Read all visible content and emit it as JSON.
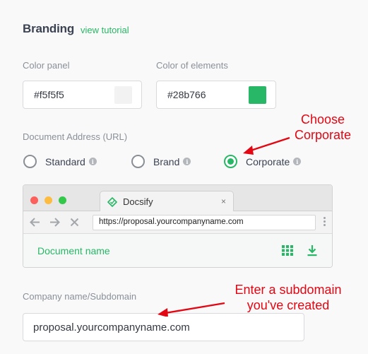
{
  "branding": {
    "title": "Branding",
    "tutorial_link": "view tutorial"
  },
  "colors": {
    "panel_label": "Color panel",
    "panel_value": "#f5f5f5",
    "elements_label": "Color of elements",
    "elements_value": "#28b766",
    "accent": "#28b766"
  },
  "address": {
    "label": "Document Address (URL)",
    "options": [
      {
        "label": "Standard",
        "checked": false
      },
      {
        "label": "Brand",
        "checked": false
      },
      {
        "label": "Corporate",
        "checked": true
      }
    ]
  },
  "browser": {
    "tab_title": "Docsify",
    "tab_close": "×",
    "url": "https://proposal.yourcompanyname.com",
    "document_name": "Document name",
    "nav_icons": [
      "back-arrow-icon",
      "forward-arrow-icon",
      "stop-icon"
    ],
    "traffic_lights": [
      "#fc605c",
      "#fdbc40",
      "#34c84a"
    ]
  },
  "company": {
    "label": "Company name/Subdomain",
    "value": "proposal.yourcompanyname.com"
  },
  "annotations": {
    "choose_line1": "Choose",
    "choose_line2": "Corporate",
    "enter_line1": "Enter a subdomain",
    "enter_line2": "you've created",
    "color": "#e30613"
  }
}
